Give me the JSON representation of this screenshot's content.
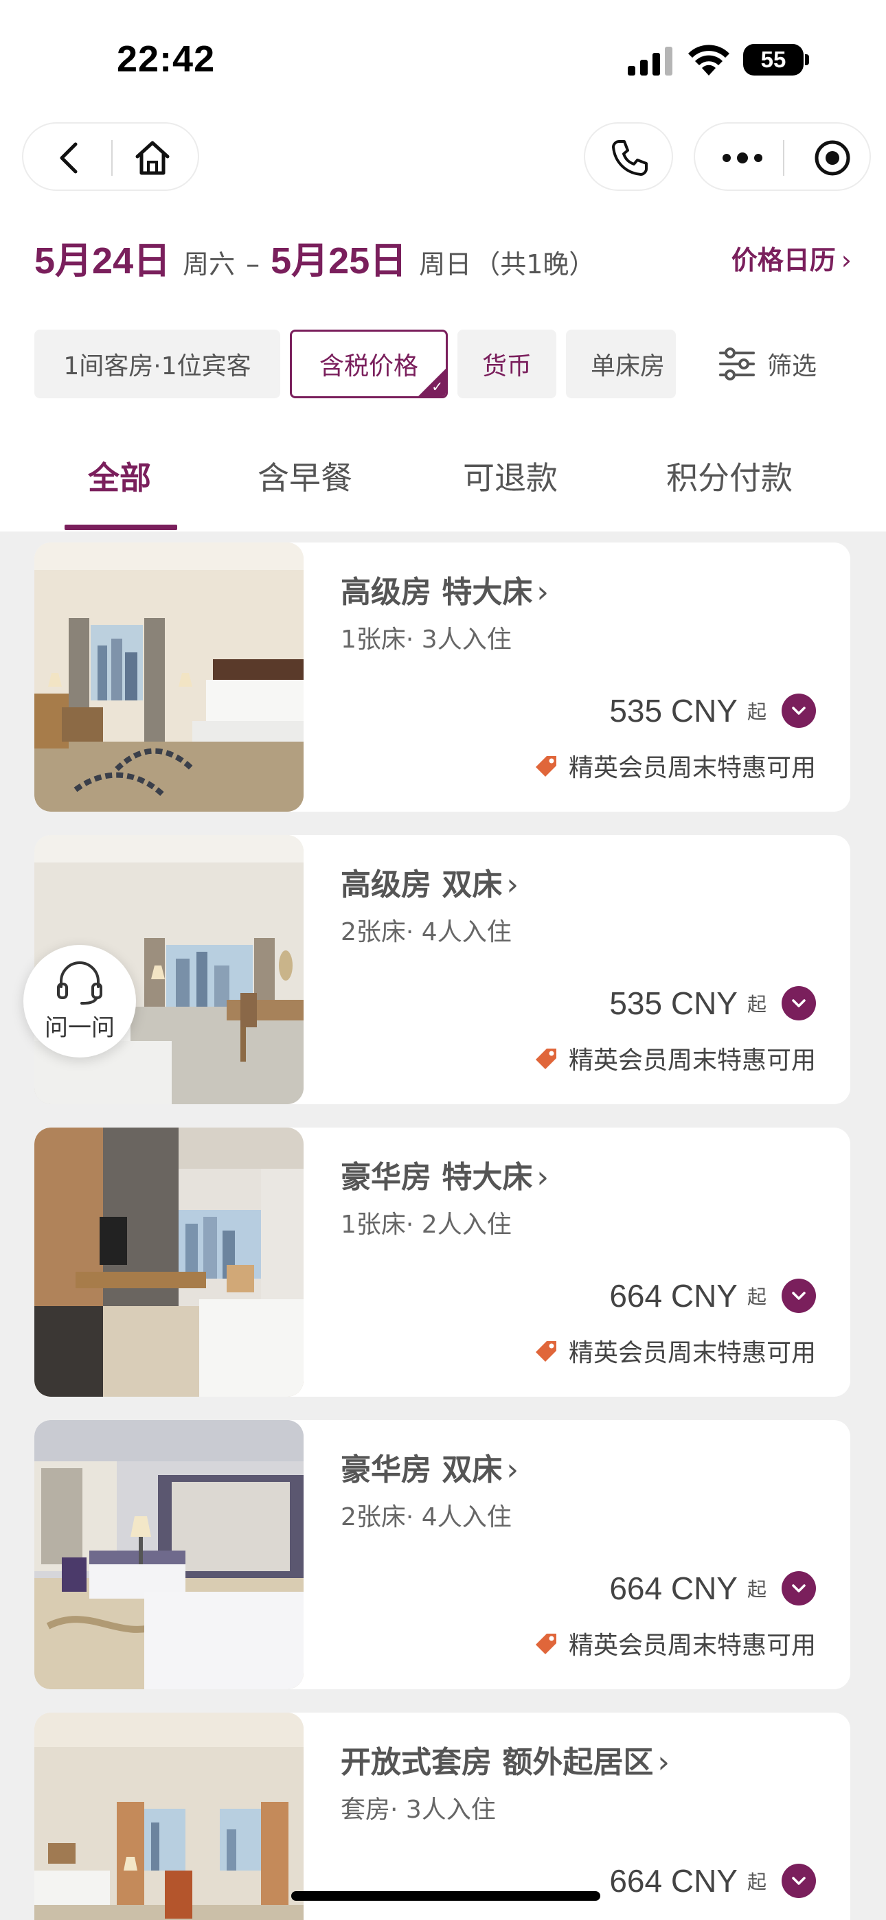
{
  "status_bar": {
    "time": "22:42",
    "battery": "55"
  },
  "dates": {
    "checkin": "5月24日",
    "checkin_weekday": "周六",
    "separator": "–",
    "checkout": "5月25日",
    "checkout_weekday": "周日",
    "nights": "（共1晚）",
    "price_calendar": "价格日历",
    "price_calendar_chevron": "›"
  },
  "filters": {
    "chips": [
      {
        "label": "1间客房·1位宾客"
      },
      {
        "label": "含税价格"
      },
      {
        "label": "货币"
      },
      {
        "label": "单床房"
      }
    ],
    "filter_label": "筛选"
  },
  "tabs": [
    {
      "label": "全部"
    },
    {
      "label": "含早餐"
    },
    {
      "label": "可退款"
    },
    {
      "label": "积分付款"
    }
  ],
  "rooms": [
    {
      "name": "高级房 特大床",
      "chevron": "›",
      "meta": "1张床· 3人入住",
      "price": "535 CNY",
      "from": "起",
      "promo": "精英会员周末特惠可用"
    },
    {
      "name": "高级房 双床",
      "chevron": "›",
      "meta": "2张床· 4人入住",
      "price": "535 CNY",
      "from": "起",
      "promo": "精英会员周末特惠可用"
    },
    {
      "name": "豪华房 特大床",
      "chevron": "›",
      "meta": "1张床· 2人入住",
      "price": "664 CNY",
      "from": "起",
      "promo": "精英会员周末特惠可用"
    },
    {
      "name": "豪华房 双床",
      "chevron": "›",
      "meta": "2张床· 4人入住",
      "price": "664 CNY",
      "from": "起",
      "promo": "精英会员周末特惠可用"
    },
    {
      "name": "开放式套房 额外起居区",
      "chevron": "›",
      "meta": "套房· 3人入住",
      "price": "664 CNY",
      "from": "起"
    }
  ],
  "ask_button": {
    "label": "问一问"
  },
  "colors": {
    "accent": "#7a1f5c",
    "promo_tag": "#e0663a",
    "list_bg": "#efefef"
  }
}
